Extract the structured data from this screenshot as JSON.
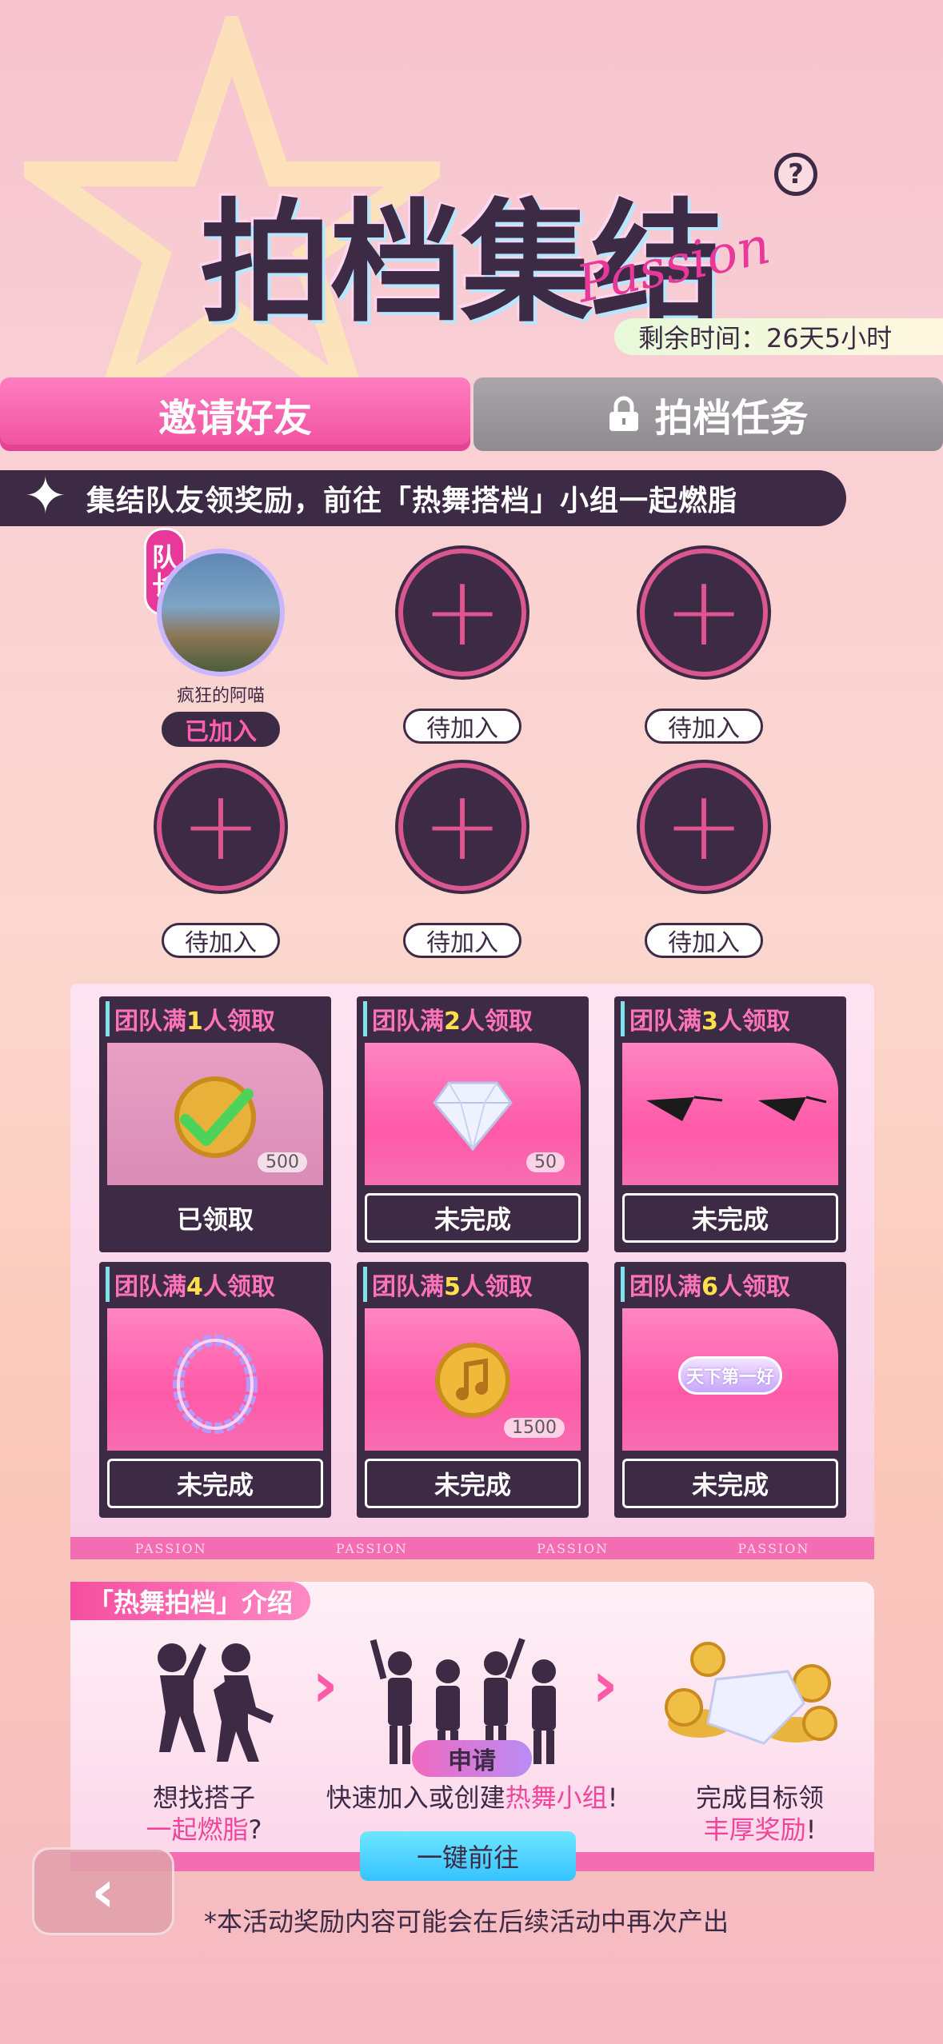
{
  "header": {
    "title": "拍档集结",
    "subtitle_script": "Passion",
    "help_label": "?",
    "timer": "剩余时间：26天5小时"
  },
  "tabs": [
    {
      "label": "邀请好友",
      "active": true
    },
    {
      "label": "拍档任务",
      "active": false,
      "locked": true
    }
  ],
  "banner": "集结队友领奖励，前往「热舞搭档」小组一起燃脂",
  "team": {
    "captain_badge": [
      "队",
      "长"
    ],
    "members": [
      {
        "name": "疯狂的阿喵",
        "status": "已加入",
        "joined": true
      },
      {
        "name": "",
        "status": "待加入",
        "joined": false
      },
      {
        "name": "",
        "status": "待加入",
        "joined": false
      },
      {
        "name": "",
        "status": "待加入",
        "joined": false
      },
      {
        "name": "",
        "status": "待加入",
        "joined": false
      },
      {
        "name": "",
        "status": "待加入",
        "joined": false
      }
    ]
  },
  "rewards": [
    {
      "prefix": "团队满",
      "count": "1",
      "suffix": "人领取",
      "item": "coin-check-icon",
      "qty": "500",
      "status": "已领取",
      "claimed": true
    },
    {
      "prefix": "团队满",
      "count": "2",
      "suffix": "人领取",
      "item": "diamond-icon",
      "qty": "50",
      "status": "未完成",
      "claimed": false
    },
    {
      "prefix": "团队满",
      "count": "3",
      "suffix": "人领取",
      "item": "sunglasses-icon",
      "qty": "",
      "status": "未完成",
      "claimed": false
    },
    {
      "prefix": "团队满",
      "count": "4",
      "suffix": "人领取",
      "item": "ring-frame-icon",
      "qty": "",
      "status": "未完成",
      "claimed": false
    },
    {
      "prefix": "团队满",
      "count": "5",
      "suffix": "人领取",
      "item": "music-coin-icon",
      "qty": "1500",
      "status": "未完成",
      "claimed": false
    },
    {
      "prefix": "团队满",
      "count": "6",
      "suffix": "人领取",
      "item": "title-badge-icon",
      "qty": "",
      "badge_text": "天下第一好",
      "status": "未完成",
      "claimed": false
    }
  ],
  "strip_text": "PASSION",
  "intro": {
    "tag": "「热舞拍档」介绍",
    "step1_a": "想找搭子",
    "step1_b_hi": "一起燃脂",
    "step1_b_tail": "?",
    "apply_label": "申请",
    "step2_a": "快速加入或创建",
    "step2_hi": "热舞小组",
    "step2_tail": "!",
    "step3_a": "完成目标领",
    "step3_hi": "丰厚奖励",
    "step3_tail": "!",
    "go_button": "一键前往"
  },
  "footer_note": "*本活动奖励内容可能会在后续活动中再次产出",
  "colors": {
    "accent": "#f0509f",
    "dark": "#3d2a45",
    "cyan": "#35c3ff"
  }
}
